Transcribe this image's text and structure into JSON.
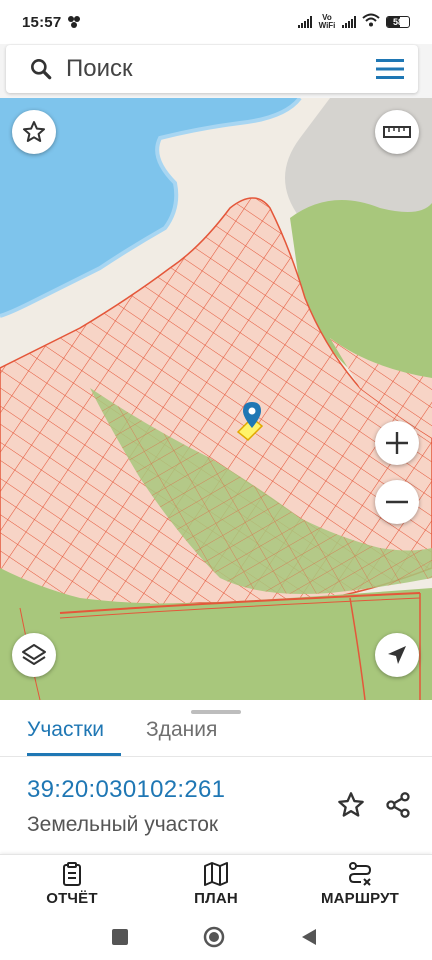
{
  "status_bar": {
    "time": "15:57",
    "network_label": "Vo WiFi",
    "battery": "58",
    "battery_level": 0.58
  },
  "search": {
    "placeholder": "Поиск",
    "search_icon": "search-icon",
    "menu_icon": "hamburger-menu-icon"
  },
  "map": {
    "colors": {
      "water": "#7ec4ec",
      "sand": "#f1ece4",
      "parcel_fill": "#f7d4c6",
      "parcel_line": "#e4573a",
      "forest": "#a8c77c",
      "grey_zone": "#d5d3cf",
      "selected": "#fff36a",
      "pin": "#1f77b4"
    },
    "controls": {
      "favorite": "star-outline-icon",
      "ruler": "ruler-icon",
      "zoom_in": "plus-icon",
      "zoom_out": "minus-icon",
      "layers": "layers-icon",
      "locate": "navigation-arrow-icon"
    }
  },
  "sheet": {
    "tabs": [
      {
        "label": "Участки",
        "active": true
      },
      {
        "label": "Здания",
        "active": false
      }
    ],
    "parcel_id": "39:20:030102:261",
    "parcel_type": "Земельный участок",
    "accent_color": "#1f77b4"
  },
  "actions": [
    {
      "label": "ОТЧЁТ",
      "icon": "clipboard-icon"
    },
    {
      "label": "ПЛАН",
      "icon": "map-icon"
    },
    {
      "label": "МАРШРУТ",
      "icon": "route-icon"
    }
  ],
  "nav": {
    "recent": "square-icon",
    "home": "circle-icon",
    "back": "triangle-back-icon"
  }
}
